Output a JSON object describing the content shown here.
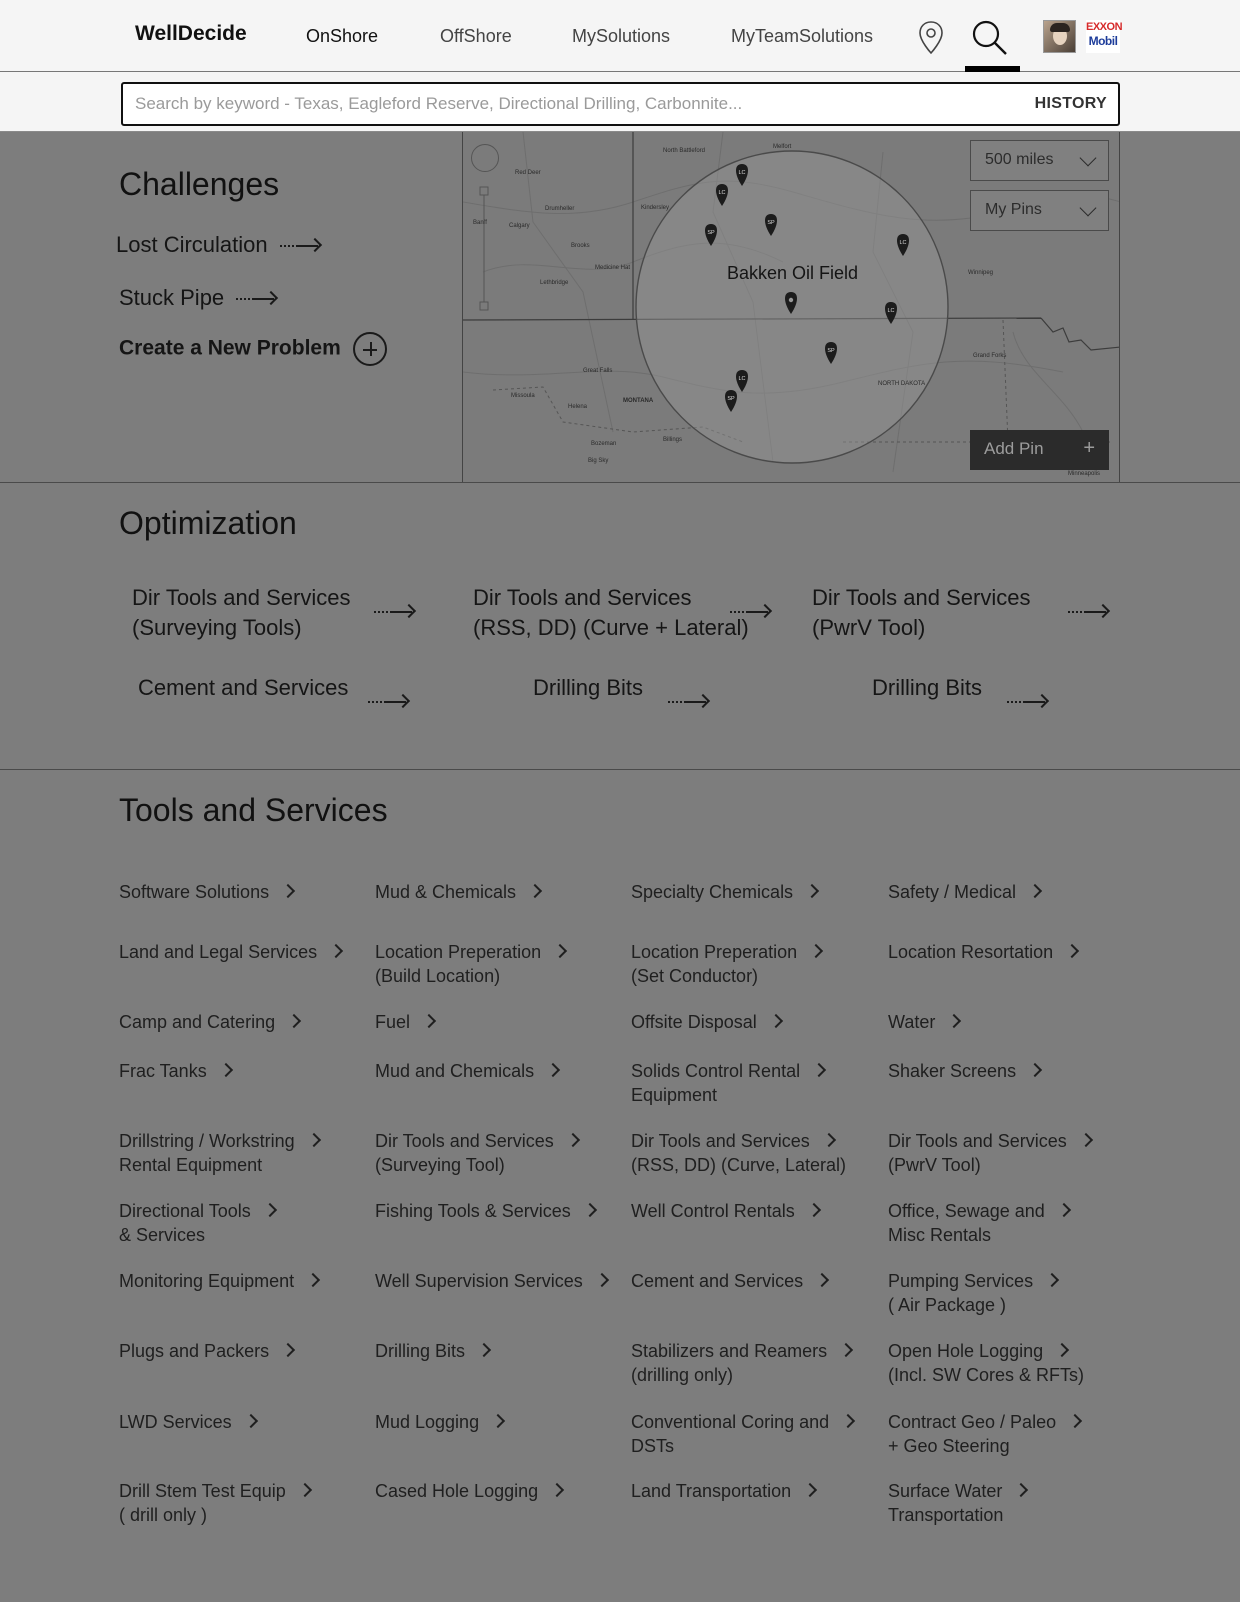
{
  "header": {
    "brand": "WellDecide",
    "nav": [
      "OnShore",
      "OffShore",
      "MySolutions",
      "MyTeamSolutions"
    ],
    "active_nav": "OnShore",
    "logo_top": "EXXON",
    "logo_bottom": "Mobil"
  },
  "search": {
    "placeholder": "Search by keyword - Texas, Eagleford Reserve, Directional Drilling, Carbonnite...",
    "history_label": "HISTORY"
  },
  "challenges": {
    "title": "Challenges",
    "links": [
      "Lost Circulation",
      "Stuck Pipe"
    ],
    "create_label": "Create a New Problem"
  },
  "map": {
    "field_label": "Bakken Oil Field",
    "radius_select": "500 miles",
    "pins_select": "My Pins",
    "add_pin_label": "Add Pin",
    "place_labels": [
      "Red Deer",
      "Calgary",
      "Drumheller",
      "Brooks",
      "Medicine Hat",
      "Lethbridge",
      "Kindersley",
      "Winnipeg",
      "Great Falls",
      "Missoula",
      "Helena",
      "MONTANA",
      "Billings",
      "Bozeman",
      "Big Sky",
      "Grand Forks",
      "NORTH DAKOTA",
      "Minneapolis",
      "Banff",
      "Melfort",
      "North Battleford"
    ],
    "pins": [
      {
        "type": "LC"
      },
      {
        "type": "LC"
      },
      {
        "type": "SP"
      },
      {
        "type": "SP"
      },
      {
        "type": "LC"
      },
      {
        "type": "field"
      },
      {
        "type": "LC"
      },
      {
        "type": "SP"
      },
      {
        "type": "LC"
      },
      {
        "type": "SP"
      }
    ]
  },
  "optimization": {
    "title": "Optimization",
    "items": [
      {
        "line1": "Dir Tools and Services",
        "line2": "(Surveying Tools)"
      },
      {
        "line1": "Dir Tools and Services",
        "line2": "(RSS, DD) (Curve + Lateral)"
      },
      {
        "line1": "Dir Tools and Services",
        "line2": "(PwrV Tool)"
      },
      {
        "line1": "Cement and Services",
        "line2": ""
      },
      {
        "line1": "Drilling Bits",
        "line2": ""
      },
      {
        "line1": "Drilling Bits",
        "line2": ""
      }
    ]
  },
  "tools": {
    "title": "Tools and Services",
    "items": [
      {
        "line1": "Software Solutions",
        "line2": ""
      },
      {
        "line1": "Mud & Chemicals",
        "line2": ""
      },
      {
        "line1": "Specialty Chemicals",
        "line2": ""
      },
      {
        "line1": "Safety / Medical",
        "line2": ""
      },
      {
        "line1": "Land and Legal Services",
        "line2": ""
      },
      {
        "line1": "Location Preperation",
        "line2": "(Build Location)"
      },
      {
        "line1": "Location Preperation",
        "line2": "(Set Conductor)"
      },
      {
        "line1": "Location Resortation",
        "line2": ""
      },
      {
        "line1": "Camp and Catering",
        "line2": ""
      },
      {
        "line1": "Fuel",
        "line2": ""
      },
      {
        "line1": "Offsite Disposal",
        "line2": ""
      },
      {
        "line1": "Water",
        "line2": ""
      },
      {
        "line1": "Frac Tanks",
        "line2": ""
      },
      {
        "line1": "Mud and Chemicals",
        "line2": ""
      },
      {
        "line1": "Solids Control Rental",
        "line2": "Equipment"
      },
      {
        "line1": "Shaker Screens",
        "line2": ""
      },
      {
        "line1": "Drillstring / Workstring",
        "line2": "Rental Equipment"
      },
      {
        "line1": "Dir Tools and Services",
        "line2": "(Surveying Tool)"
      },
      {
        "line1": "Dir Tools and Services",
        "line2": "(RSS, DD) (Curve, Lateral)"
      },
      {
        "line1": "Dir Tools and Services",
        "line2": "(PwrV Tool)"
      },
      {
        "line1": "Directional Tools",
        "line2": "& Services"
      },
      {
        "line1": "Fishing Tools & Services",
        "line2": ""
      },
      {
        "line1": "Well Control Rentals",
        "line2": ""
      },
      {
        "line1": "Office, Sewage and",
        "line2": "Misc Rentals"
      },
      {
        "line1": "Monitoring Equipment",
        "line2": ""
      },
      {
        "line1": "Well Supervision Services",
        "line2": ""
      },
      {
        "line1": "Cement and Services",
        "line2": ""
      },
      {
        "line1": "Pumping Services",
        "line2": "( Air Package )"
      },
      {
        "line1": "Plugs and Packers",
        "line2": ""
      },
      {
        "line1": "Drilling Bits",
        "line2": ""
      },
      {
        "line1": "Stabilizers and Reamers",
        "line2": "(drilling only)"
      },
      {
        "line1": "Open Hole Logging",
        "line2": "(Incl. SW Cores & RFTs)"
      },
      {
        "line1": "LWD Services",
        "line2": ""
      },
      {
        "line1": "Mud Logging",
        "line2": ""
      },
      {
        "line1": "Conventional Coring and",
        "line2": "DSTs"
      },
      {
        "line1": "Contract Geo / Paleo",
        "line2": "+ Geo Steering"
      },
      {
        "line1": "Drill Stem Test Equip",
        "line2": "( drill only )"
      },
      {
        "line1": "Cased Hole Logging",
        "line2": ""
      },
      {
        "line1": "Land Transportation",
        "line2": ""
      },
      {
        "line1": "Surface Water",
        "line2": "Transportation"
      }
    ]
  }
}
